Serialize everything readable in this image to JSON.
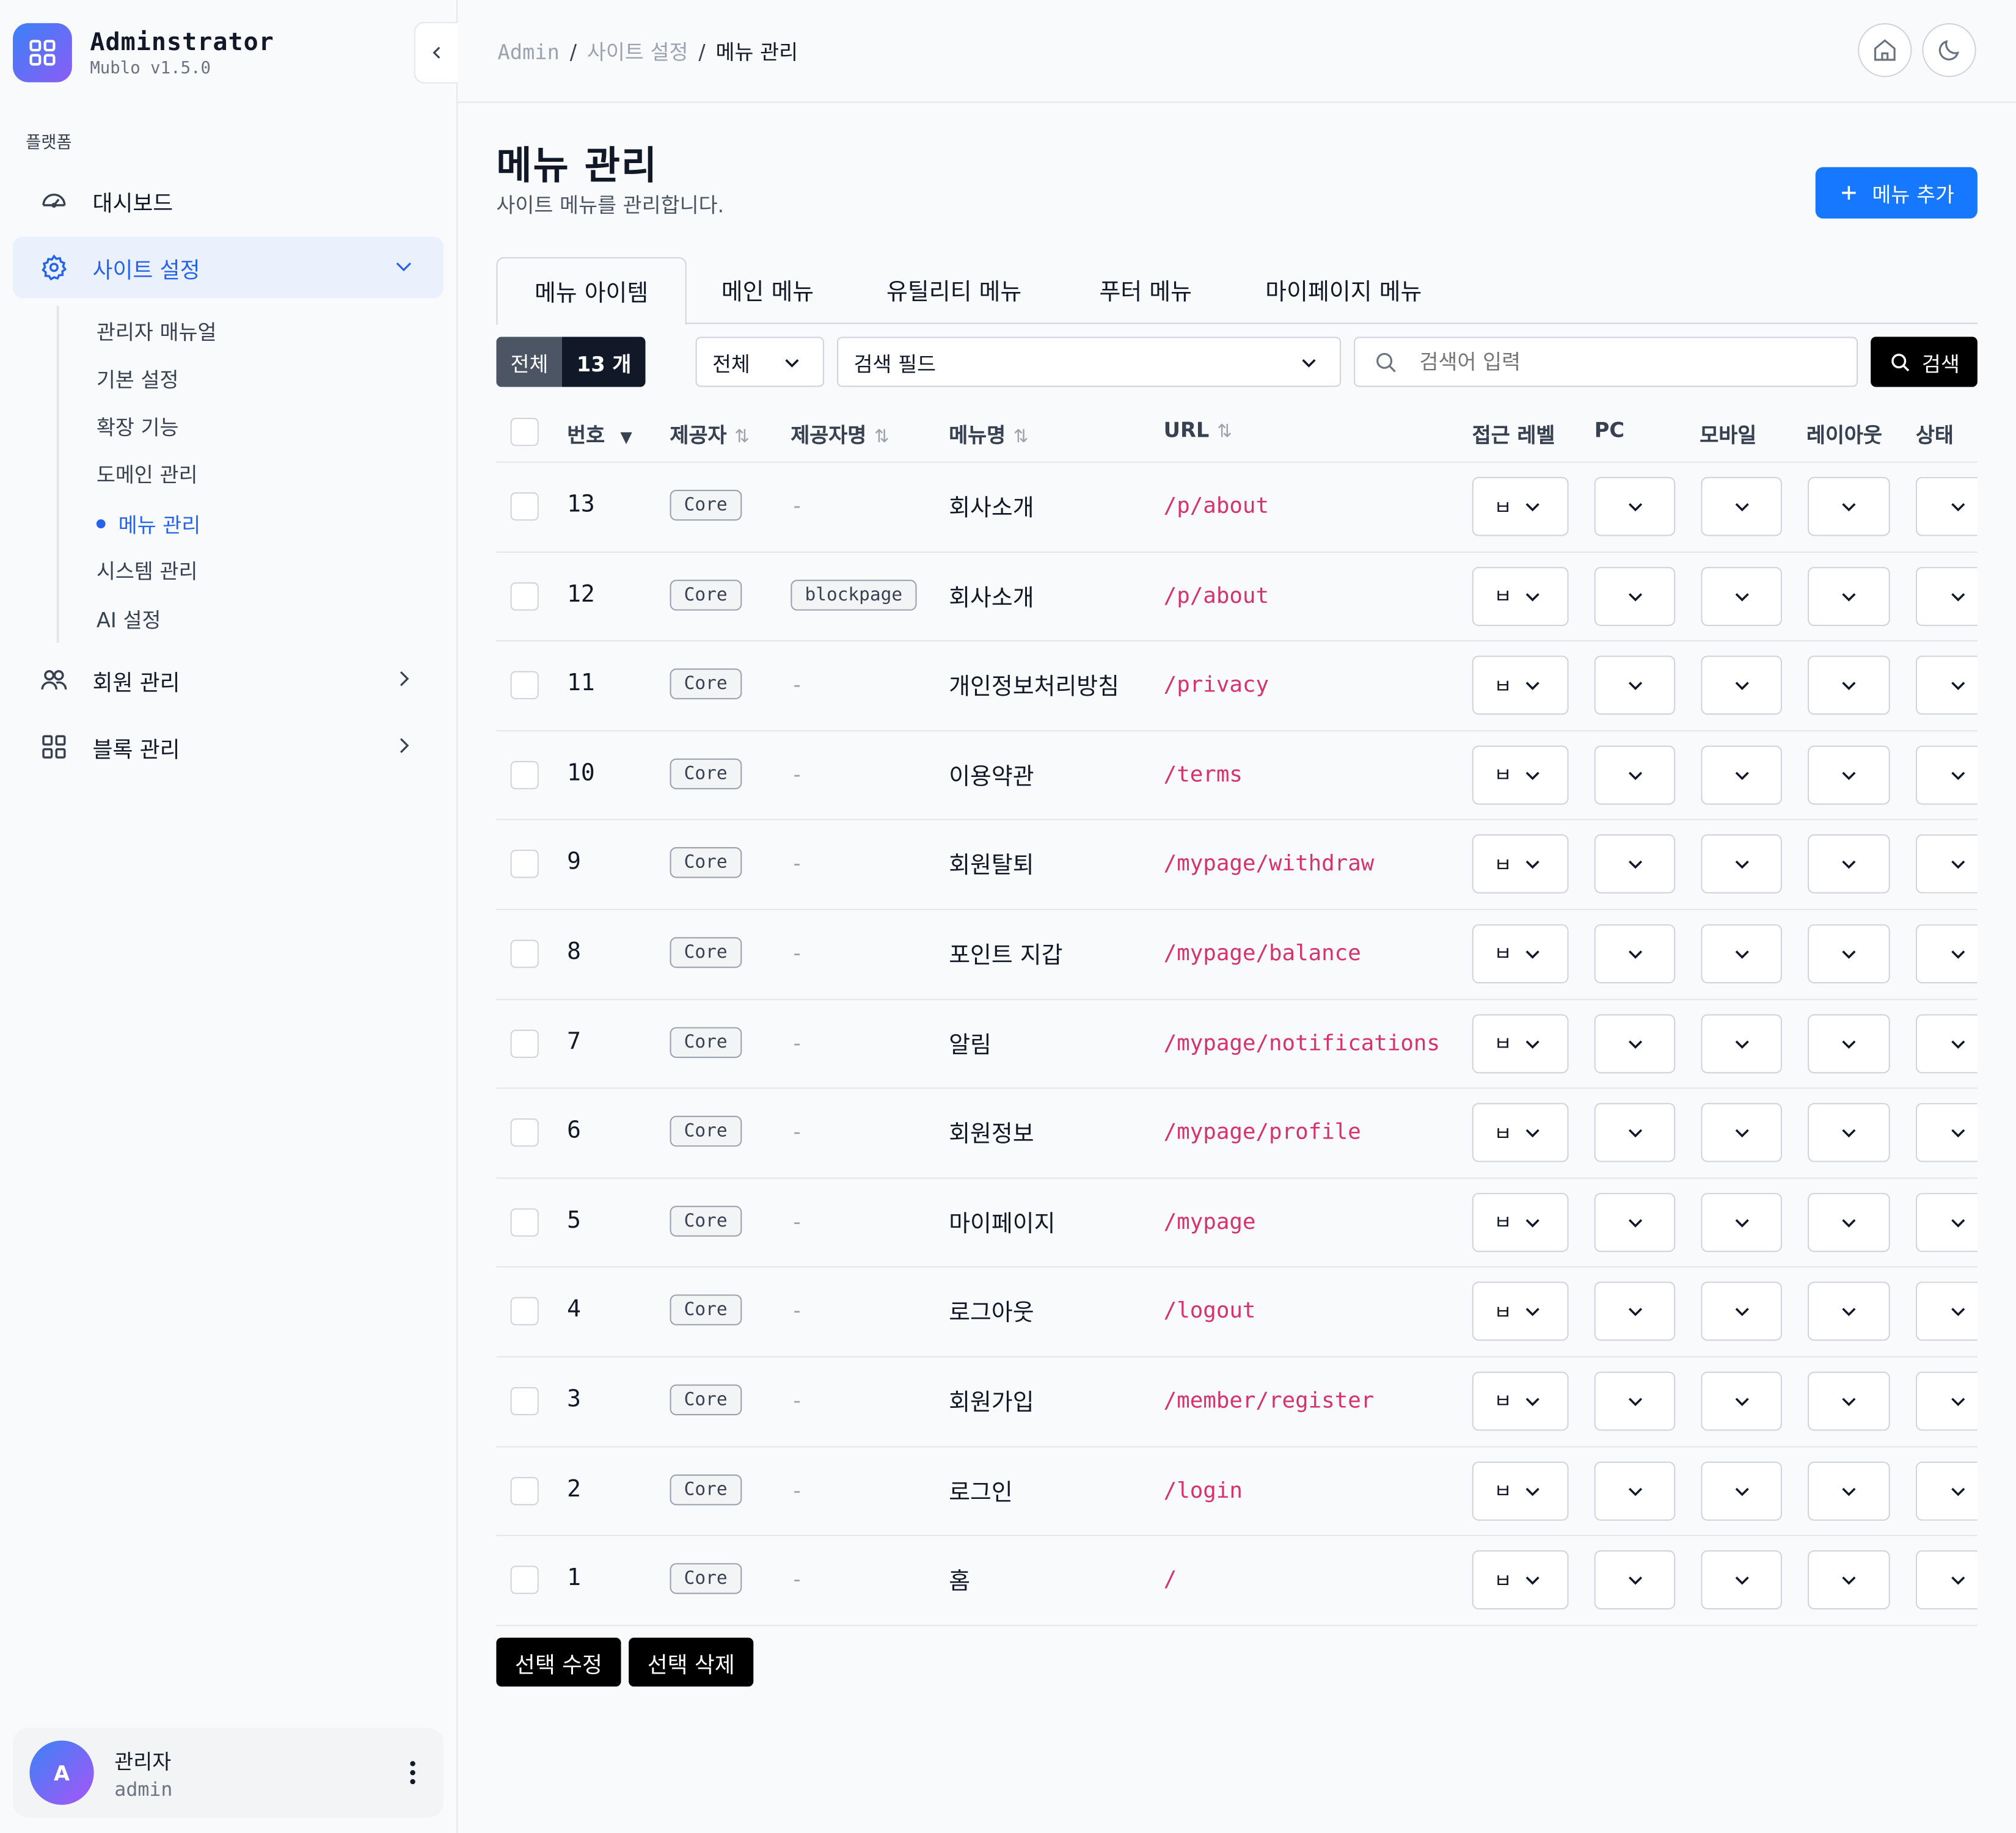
{
  "brand": {
    "title": "Adminstrator",
    "version": "Mublo v1.5.0"
  },
  "sidebar": {
    "section_label": "플랫폼",
    "items": [
      {
        "label": "대시보드",
        "icon": "dashboard-gauge-icon"
      },
      {
        "label": "사이트 설정",
        "icon": "gear-icon"
      },
      {
        "label": "회원 관리",
        "icon": "users-icon"
      },
      {
        "label": "블록 관리",
        "icon": "blocks-grid-icon"
      }
    ],
    "submenu": [
      "관리자 매뉴얼",
      "기본 설정",
      "확장 기능",
      "도메인 관리",
      "메뉴 관리",
      "시스템 관리",
      "AI 설정"
    ],
    "active_sub": "메뉴 관리"
  },
  "user": {
    "initial": "A",
    "name": "관리자",
    "id": "admin"
  },
  "breadcrumb": {
    "root": "Admin",
    "parent": "사이트 설정",
    "current": "메뉴 관리",
    "sep": "/"
  },
  "page": {
    "title": "메뉴 관리",
    "subtitle": "사이트 메뉴를 관리합니다.",
    "add_button": "메뉴 추가"
  },
  "tabs": [
    "메뉴 아이템",
    "메인 메뉴",
    "유틸리티 메뉴",
    "푸터 메뉴",
    "마이페이지 메뉴"
  ],
  "filters": {
    "total_label": "전체",
    "total_count": "13 개",
    "scope_select": "전체",
    "field_select": "검색 필드",
    "search_placeholder": "검색어 입력",
    "search_button": "검색"
  },
  "table": {
    "columns": [
      "번호",
      "제공자",
      "제공자명",
      "메뉴명",
      "URL",
      "접근 레벨",
      "PC",
      "모바일",
      "레이아웃",
      "상태"
    ],
    "rows": [
      {
        "no": "13",
        "provider": "Core",
        "provider_name": "-",
        "name": "회사소개",
        "url": "/p/about",
        "level": "ㅂ"
      },
      {
        "no": "12",
        "provider": "Core",
        "provider_name": "blockpage",
        "name": "회사소개",
        "url": "/p/about",
        "level": "ㅂ"
      },
      {
        "no": "11",
        "provider": "Core",
        "provider_name": "-",
        "name": "개인정보처리방침",
        "url": "/privacy",
        "level": "ㅂ"
      },
      {
        "no": "10",
        "provider": "Core",
        "provider_name": "-",
        "name": "이용약관",
        "url": "/terms",
        "level": "ㅂ"
      },
      {
        "no": "9",
        "provider": "Core",
        "provider_name": "-",
        "name": "회원탈퇴",
        "url": "/mypage/withdraw",
        "level": "ㅂ"
      },
      {
        "no": "8",
        "provider": "Core",
        "provider_name": "-",
        "name": "포인트 지갑",
        "url": "/mypage/balance",
        "level": "ㅂ"
      },
      {
        "no": "7",
        "provider": "Core",
        "provider_name": "-",
        "name": "알림",
        "url": "/mypage/notifications",
        "level": "ㅂ"
      },
      {
        "no": "6",
        "provider": "Core",
        "provider_name": "-",
        "name": "회원정보",
        "url": "/mypage/profile",
        "level": "ㅂ"
      },
      {
        "no": "5",
        "provider": "Core",
        "provider_name": "-",
        "name": "마이페이지",
        "url": "/mypage",
        "level": "ㅂ"
      },
      {
        "no": "4",
        "provider": "Core",
        "provider_name": "-",
        "name": "로그아웃",
        "url": "/logout",
        "level": "ㅂ"
      },
      {
        "no": "3",
        "provider": "Core",
        "provider_name": "-",
        "name": "회원가입",
        "url": "/member/register",
        "level": "ㅂ"
      },
      {
        "no": "2",
        "provider": "Core",
        "provider_name": "-",
        "name": "로그인",
        "url": "/login",
        "level": "ㅂ"
      },
      {
        "no": "1",
        "provider": "Core",
        "provider_name": "-",
        "name": "홈",
        "url": "/",
        "level": "ㅂ"
      }
    ]
  },
  "bulk": {
    "edit": "선택 수정",
    "delete": "선택 삭제"
  },
  "colors": {
    "accent": "#1677ff",
    "active_nav_bg": "#eaf1fd",
    "url_text": "#d6336c"
  }
}
